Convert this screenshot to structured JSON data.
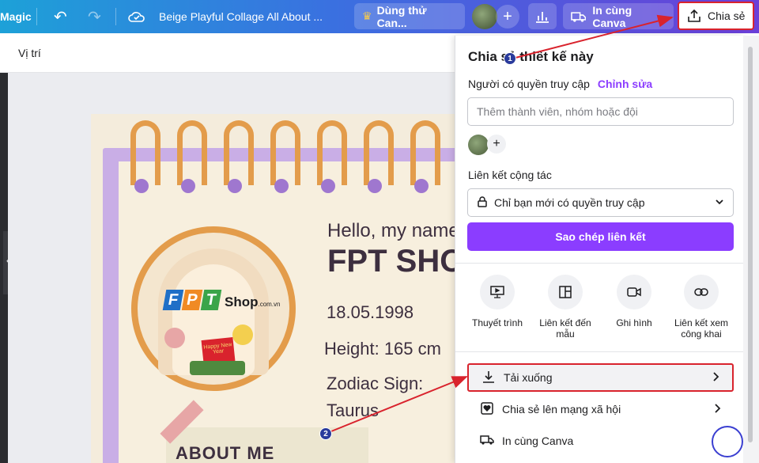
{
  "topbar": {
    "magic_label": "Magic",
    "doc_title": "Beige Playful Collage All About ...",
    "try_label": "Dùng thử Can...",
    "print_label": "In cùng Canva",
    "share_label": "Chia sẻ"
  },
  "subbar": {
    "position_label": "Vị trí"
  },
  "poster": {
    "greeting": "Hello, my name",
    "name": "FPT SHO",
    "birthday": "18.05.1998",
    "height": "Height: 165 cm",
    "zodiac_label": "Zodiac Sign:",
    "zodiac_value": "Taurus",
    "about_heading": "ABOUT ME",
    "logo_letters": [
      "F",
      "P",
      "T"
    ],
    "logo_shop": "Shop",
    "logo_domain": ".com.vn",
    "tet_card": "Happy New Year"
  },
  "share_panel": {
    "title": "Chia sẻ thiết kế này",
    "access_label": "Người có quyền truy cập",
    "edit_link": "Chỉnh sửa",
    "member_placeholder": "Thêm thành viên, nhóm hoặc đội",
    "collab_label": "Liên kết cộng tác",
    "access_option": "Chỉ bạn mới có quyền truy cập",
    "copy_button": "Sao chép liên kết",
    "options": [
      {
        "label": "Thuyết trình",
        "icon": "present-icon"
      },
      {
        "label": "Liên kết đến mẫu",
        "icon": "template-icon"
      },
      {
        "label": "Ghi hình",
        "icon": "record-icon"
      },
      {
        "label": "Liên kết xem công khai",
        "icon": "link-icon"
      }
    ],
    "rows": [
      {
        "label": "Tải xuống",
        "icon": "download-icon"
      },
      {
        "label": "Chia sẻ lên mạng xã hội",
        "icon": "heart-icon"
      },
      {
        "label": "In cùng Canva",
        "icon": "truck-icon"
      }
    ]
  },
  "annotations": {
    "step1": "1",
    "step2": "2"
  },
  "colors": {
    "accent": "#8b3dff",
    "highlight": "#d9232d",
    "ring": "#e39c4b",
    "notebook_purple": "#c9aee6"
  }
}
